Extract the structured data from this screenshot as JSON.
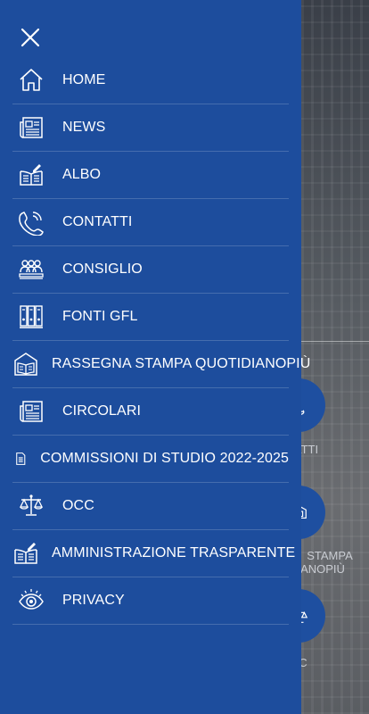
{
  "drawer": {
    "close_icon": "close-icon",
    "items": [
      {
        "label": "HOME",
        "icon": "home-icon"
      },
      {
        "label": "NEWS",
        "icon": "newspaper-icon"
      },
      {
        "label": "ALBO",
        "icon": "book-pen-icon"
      },
      {
        "label": "CONTATTI",
        "icon": "phone-icon"
      },
      {
        "label": "CONSIGLIO",
        "icon": "people-icon"
      },
      {
        "label": "FONTI GFL",
        "icon": "binders-icon"
      },
      {
        "label": "RASSEGNA STAMPA QUOTIDIANOPIÙ",
        "icon": "open-book-house-icon"
      },
      {
        "label": "CIRCOLARI",
        "icon": "newspaper-icon"
      },
      {
        "label": "COMMISSIONI DI STUDIO 2022-2025",
        "icon": "document-icon"
      },
      {
        "label": "OCC",
        "icon": "scales-icon"
      },
      {
        "label": "AMMINISTRAZIONE TRASPARENTE",
        "icon": "book-pen-icon"
      },
      {
        "label": "PRIVACY",
        "icon": "eye-icon"
      }
    ]
  },
  "background": {
    "labels": {
      "contatti": "TATTI",
      "rassegna_line1": "STAMPA",
      "rassegna_line2": "ANOPIÙ",
      "occ": "C"
    }
  },
  "colors": {
    "drawer": "#1d4d9d",
    "text": "#ffffff",
    "divider": "rgba(255,255,255,0.18)"
  }
}
